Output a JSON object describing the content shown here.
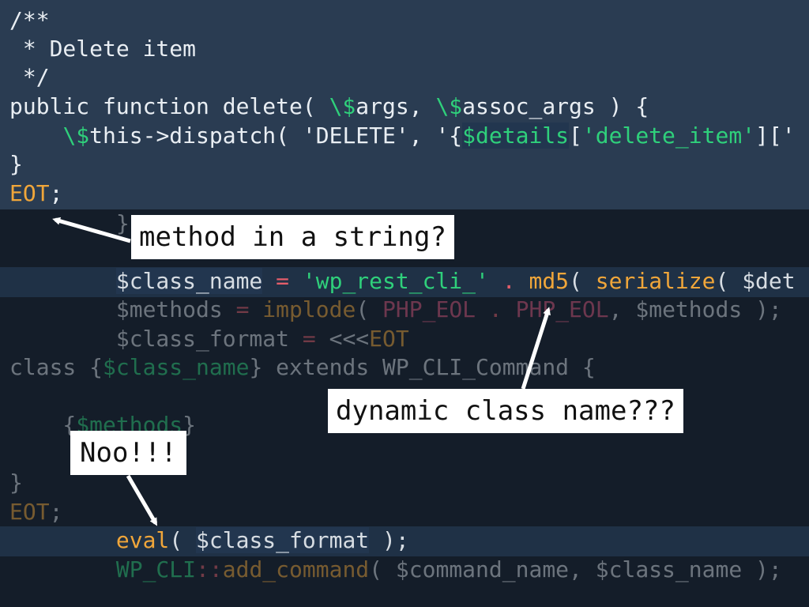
{
  "colors": {
    "background": "#141d29",
    "highlight_band": "#2a3c52",
    "selection_band": "#203144",
    "text": "#e9eef3",
    "orange": "#f0a63a",
    "green": "#2fd07b",
    "variable": "#d7dde3",
    "constant": "#d9577c",
    "operator": "#e35d6a",
    "callout_bg": "#ffffff",
    "callout_text": "#111111"
  },
  "code": {
    "l1": "/**",
    "l2": " * Delete item",
    "l3": " */",
    "l4a": "public function delete( ",
    "l4b": "\\$",
    "l4c": "args, ",
    "l4d": "\\$",
    "l4e": "assoc_args ) {",
    "l5a": "    ",
    "l5b": "\\$",
    "l5c": "this->dispatch( 'DELETE', '{",
    "l5d": "$details",
    "l5e": "[",
    "l5f": "'delete_item'",
    "l5g": "]['",
    "l6": "}",
    "l7a": "EOT",
    "l7b": ";",
    "l8": "        }",
    "l9a": "        ",
    "l9b": "$class_name",
    "l9c": " = ",
    "l9d": "'wp_rest_cli_'",
    "l9e": " . ",
    "l9f": "md5",
    "l9g": "( ",
    "l9h": "serialize",
    "l9i": "( ",
    "l9j": "$det",
    "l10a": "        ",
    "l10b": "$methods",
    "l10c": " = ",
    "l10d": "implode",
    "l10e": "( ",
    "l10f": "PHP_EOL",
    "l10g": " . ",
    "l10h": "PHP_EOL",
    "l10i": ", ",
    "l10j": "$methods",
    "l10k": " );",
    "l11a": "        ",
    "l11b": "$class_format",
    "l11c": " = ",
    "l11d": "<<<",
    "l11e": "EOT",
    "l12a": "class {",
    "l12b": "$class_name",
    "l12c": "} extends WP_CLI_Command {",
    "l14a": "    {",
    "l14b": "$methods",
    "l14c": "}",
    "l16": "}",
    "l17a": "EOT",
    "l17b": ";",
    "l18a": "        ",
    "l18b": "eval",
    "l18c": "( ",
    "l18d": "$class_format",
    "l18e": " );",
    "l19a": "        ",
    "l19b": "WP_CLI",
    "l19c": "::",
    "l19d": "add_command",
    "l19e": "( ",
    "l19f": "$command_name",
    "l19g": ", ",
    "l19h": "$class_name",
    "l19i": " );"
  },
  "callouts": {
    "method_string": "method in a string?",
    "dynamic_class": "dynamic class name???",
    "noo": "Noo!!!"
  }
}
